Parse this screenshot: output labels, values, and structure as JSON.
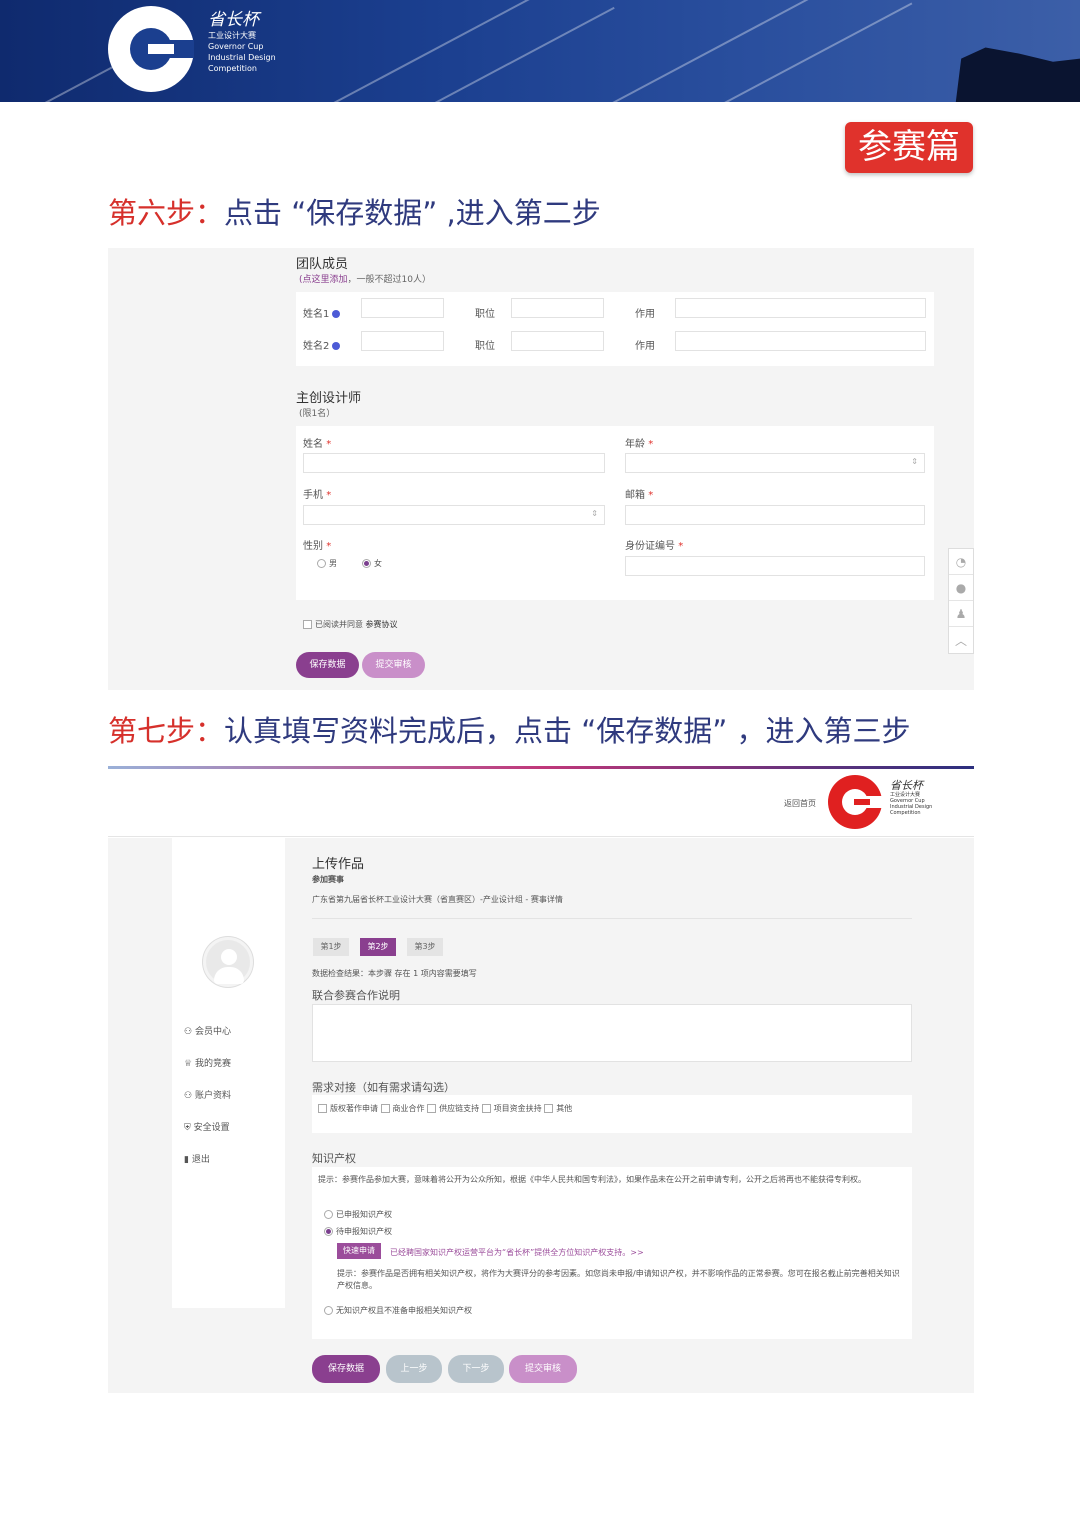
{
  "banner": {
    "logo_cn": "省长杯",
    "logo_lines": [
      "工业设计大赛",
      "Governor Cup",
      "Industrial Design",
      "Competition"
    ]
  },
  "badge": "参赛篇",
  "step6": {
    "prefix": "第六步：",
    "text": "点击 “保存数据” ,进入第二步"
  },
  "team": {
    "title": "团队成员",
    "hint_link": "(点这里添加",
    "hint_rest": "，一般不超过10人）",
    "rows": [
      {
        "name_label": "姓名1",
        "position_label": "职位",
        "role_label": "作用"
      },
      {
        "name_label": "姓名2",
        "position_label": "职位",
        "role_label": "作用"
      }
    ]
  },
  "designer": {
    "title": "主创设计师",
    "limit": "(限1名）",
    "name_label": "姓名",
    "age_label": "年龄",
    "phone_label": "手机",
    "email_label": "邮箱",
    "gender_label": "性别",
    "gender_male": "男",
    "gender_female": "女",
    "id_label": "身份证编号",
    "required_mark": "*"
  },
  "agreement": {
    "prefix": "已阅读并同意",
    "link": "参赛协议"
  },
  "buttons1": {
    "save": "保存数据",
    "submit": "提交审核"
  },
  "step7": {
    "prefix": "第七步：",
    "text": "认真填写资料完成后，点击 “保存数据” ，进入第三步"
  },
  "header2": {
    "back_home": "返回首页",
    "logo_cn": "省长杯",
    "logo_lines": [
      "工业设计大赛",
      "Governor Cup",
      "Industrial Design",
      "Competition"
    ]
  },
  "sidebar": {
    "items": [
      {
        "label": "会员中心",
        "icon": "user-icon"
      },
      {
        "label": "我的竞赛",
        "icon": "trophy-icon"
      },
      {
        "label": "账户资料",
        "icon": "user-icon"
      },
      {
        "label": "安全设置",
        "icon": "shield-icon"
      },
      {
        "label": "退出",
        "icon": "exit-icon"
      }
    ]
  },
  "upload": {
    "title": "上传作品",
    "event_label": "参加赛事",
    "event_value": "广东省第九届省长杯工业设计大赛（省直赛区）-产业设计组 - 赛事详情",
    "tabs": [
      "第1步",
      "第2步",
      "第3步"
    ],
    "active_tab": 1,
    "check_result": "数据检查结果：本步骤 存在 1 项内容需要填写",
    "coop_title": "联合参赛合作说明",
    "demand_title": "需求对接（如有需求请勾选）",
    "demand_options": [
      "版权著作申请",
      "商业合作",
      "供应链支持",
      "项目资金扶持",
      "其他"
    ],
    "ip_title": "知识产权",
    "ip_tip": "提示：参赛作品参加大赛，意味着将公开为公众所知，根据《中华人民共和国专利法》，如果作品未在公开之前申请专利，公开之后将再也不能获得专利权。",
    "ip_option1": "已申报知识产权",
    "ip_option2": "待申报知识产权",
    "ip_option3": "无知识产权且不准备申报相关知识产权",
    "ip_selected": 2,
    "ip_apply_tag": "快速申请",
    "ip_apply_text": "已经聘国家知识产权运营平台为“省长杯”提供全方位知识产权支持。>>",
    "ip_note": "提示：参赛作品是否拥有相关知识产权，将作为大赛评分的参考因素。如您尚未申报/申请知识产权，并不影响作品的正常参赛。您可在报名截止前完善相关知识产权信息。"
  },
  "buttons2": {
    "save": "保存数据",
    "prev": "上一步",
    "next": "下一步",
    "submit": "提交审核"
  },
  "social_icons": [
    "weibo-icon",
    "wechat-icon",
    "qq-icon",
    "back-to-top-icon"
  ],
  "colors": {
    "banner": "#1b3f8f",
    "badge": "#e0322c",
    "accent_purple": "#8a3f8f",
    "title_blue": "#2f3a7e",
    "title_red": "#d6302b"
  }
}
